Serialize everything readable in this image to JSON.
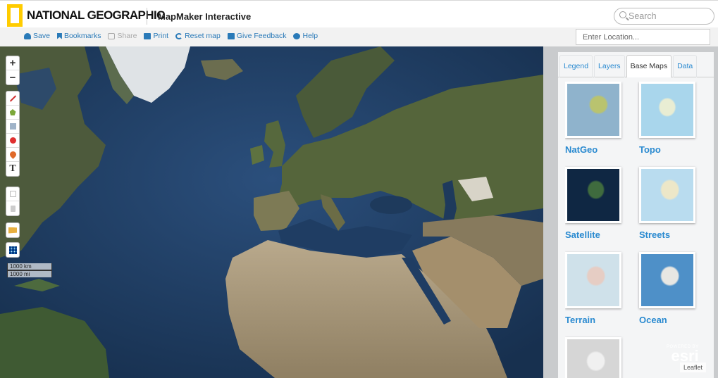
{
  "brand": {
    "name": "NATIONAL GEOGRAPHIC",
    "app_title": "MapMaker Interactive",
    "accent": "#ffcc00"
  },
  "search": {
    "placeholder": "Search"
  },
  "toolbar": {
    "items": [
      {
        "label": "Save",
        "icon": "cloud-icon",
        "enabled": true
      },
      {
        "label": "Bookmarks",
        "icon": "bookmark-icon",
        "enabled": true
      },
      {
        "label": "Share",
        "icon": "share-icon",
        "enabled": false
      },
      {
        "label": "Print",
        "icon": "print-icon",
        "enabled": true
      },
      {
        "label": "Reset map",
        "icon": "refresh-icon",
        "enabled": true
      },
      {
        "label": "Give Feedback",
        "icon": "mail-icon",
        "enabled": true
      },
      {
        "label": "Help",
        "icon": "help-icon",
        "enabled": true
      }
    ],
    "link_color": "#2a7ab8"
  },
  "location": {
    "placeholder": "Enter Location..."
  },
  "map_controls": {
    "zoom_in": "+",
    "zoom_out": "−",
    "draw_tools": [
      "line-tool-icon",
      "polygon-tool-icon",
      "rectangle-tool-icon",
      "circle-tool-icon",
      "marker-tool-icon",
      "text-tool-icon"
    ],
    "text_tool_label": "T",
    "edit_tools": [
      "edit-icon",
      "delete-icon"
    ],
    "extra_tools": [
      "flag-icon",
      "grid-icon"
    ]
  },
  "scale": {
    "top": "1000 km",
    "bottom": "1000 mi"
  },
  "panel": {
    "tabs": [
      {
        "label": "Legend",
        "active": false
      },
      {
        "label": "Layers",
        "active": false
      },
      {
        "label": "Base Maps",
        "active": true
      },
      {
        "label": "Data",
        "active": false
      }
    ],
    "basemaps": [
      "NatGeo",
      "Topo",
      "Satellite",
      "Streets",
      "Terrain",
      "Ocean"
    ]
  },
  "attribution": {
    "powered_by": "POWERED BY",
    "esri": "esri",
    "leaflet": "Leaflet"
  }
}
